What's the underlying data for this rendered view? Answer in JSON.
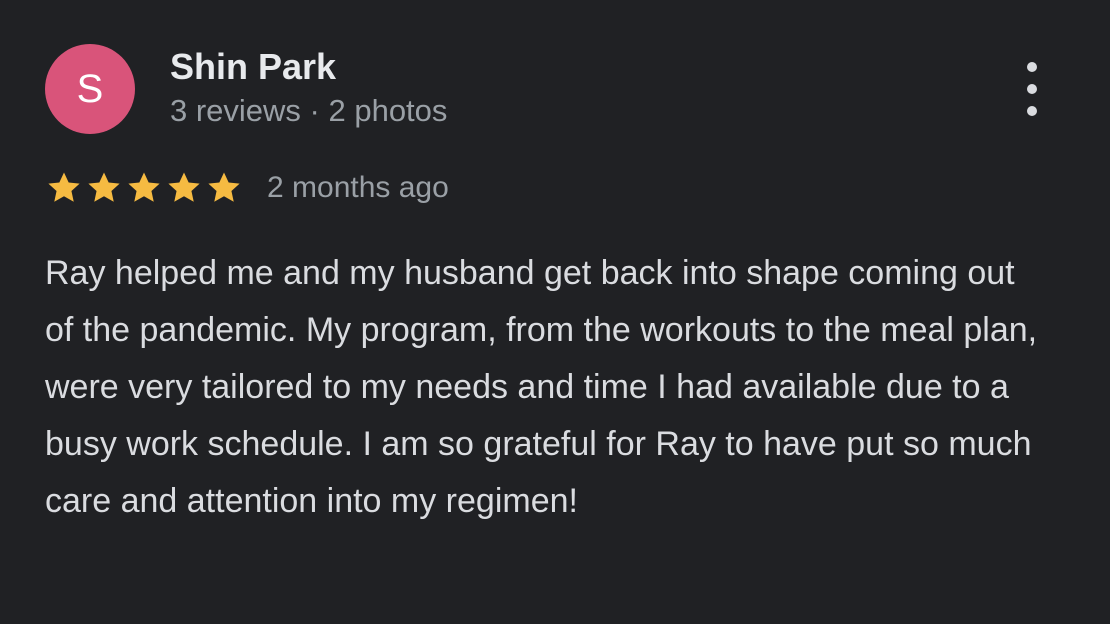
{
  "author": {
    "initial": "S",
    "name": "Shin Park",
    "meta": "3 reviews · 2 photos",
    "avatar_color": "#d9547a"
  },
  "rating": {
    "stars": 5,
    "max": 5,
    "star_color": "#f6bb42",
    "date": "2 months ago"
  },
  "review": {
    "text": "Ray helped me and my husband get back into shape coming out of the pandemic. My program, from the workouts to the meal plan, were very tailored to my needs and time I had available due to a busy work schedule. I am so grateful for Ray to have put so much care and attention into my regimen!"
  },
  "icons": {
    "more": "more-vert-icon",
    "star": "star-icon"
  }
}
